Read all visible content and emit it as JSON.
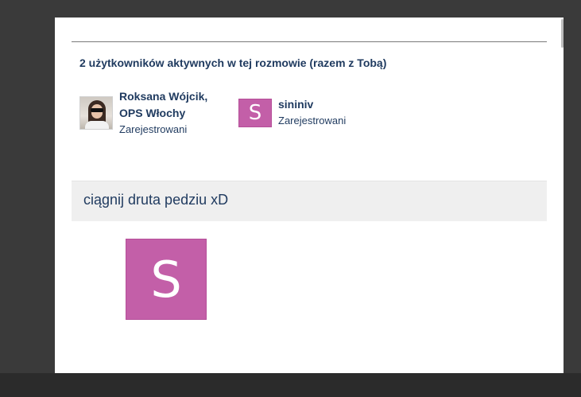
{
  "participants_heading": "2 użytkowników aktywnych w tej rozmowie (razem z Tobą)",
  "users": [
    {
      "name_line1": "Roksana Wójcik,",
      "name_line2": "OPS Włochy",
      "status": "Zarejestrowani",
      "avatar": "profile-photo"
    },
    {
      "name": "sininiv",
      "status": "Zarejestrowani",
      "avatar_letter": "S",
      "avatar_color": "#c35fa8"
    }
  ],
  "message": {
    "text": "ciągnij druta pedziu xD"
  },
  "big_avatar": {
    "letter": "S",
    "color": "#c35fa8"
  }
}
